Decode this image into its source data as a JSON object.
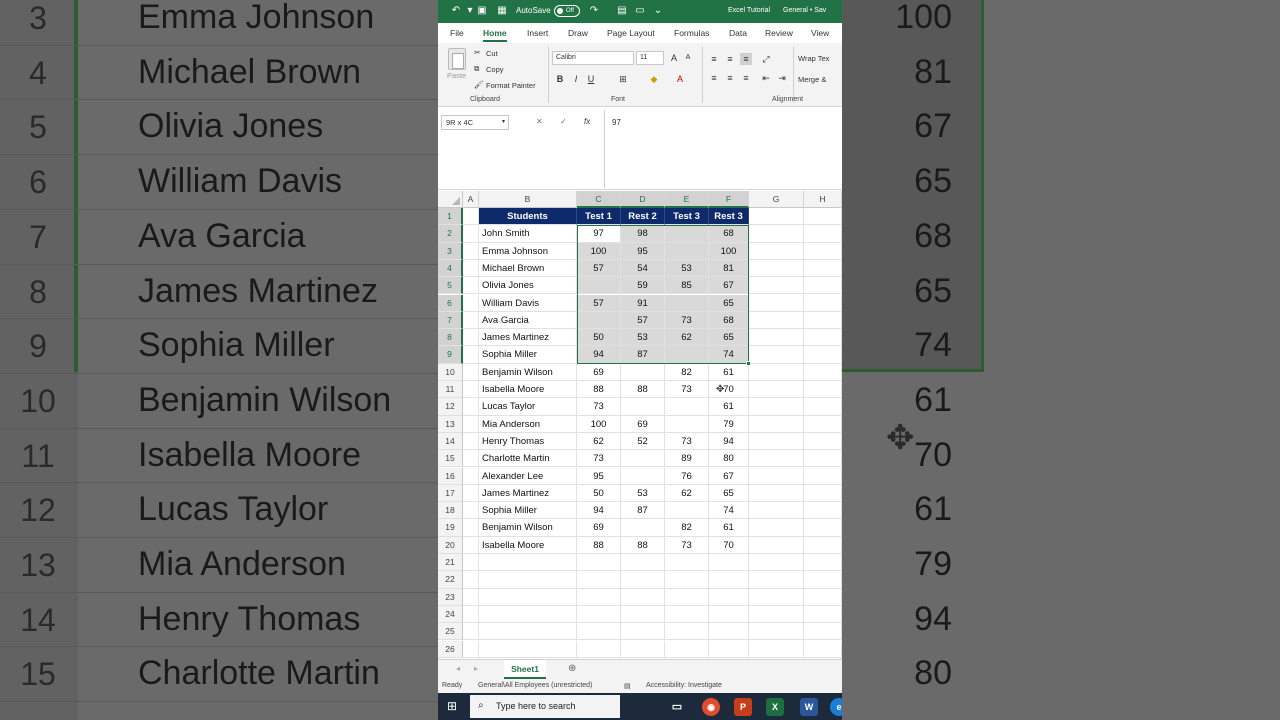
{
  "background": {
    "left_rows": [
      {
        "num": "3",
        "name": "Emma Johnson"
      },
      {
        "num": "4",
        "name": "Michael Brown"
      },
      {
        "num": "5",
        "name": "Olivia Jones"
      },
      {
        "num": "6",
        "name": "William Davis"
      },
      {
        "num": "7",
        "name": "Ava Garcia"
      },
      {
        "num": "8",
        "name": "James Martinez"
      },
      {
        "num": "9",
        "name": "Sophia Miller"
      },
      {
        "num": "10",
        "name": "Benjamin Wilson"
      },
      {
        "num": "11",
        "name": "Isabella Moore"
      },
      {
        "num": "12",
        "name": "Lucas Taylor"
      },
      {
        "num": "13",
        "name": "Mia Anderson"
      },
      {
        "num": "14",
        "name": "Henry Thomas"
      },
      {
        "num": "15",
        "name": "Charlotte Martin"
      }
    ],
    "right_values": [
      "100",
      "81",
      "67",
      "65",
      "68",
      "65",
      "74",
      "61",
      "70",
      "61",
      "79",
      "94",
      "80"
    ]
  },
  "titlebar": {
    "autosave_label": "AutoSave",
    "autosave_state": "Off",
    "doc_title": "Excel Tutorial",
    "sensitivity": "General • Sav"
  },
  "tabs": [
    "File",
    "Home",
    "Insert",
    "Draw",
    "Page Layout",
    "Formulas",
    "Data",
    "Review",
    "View"
  ],
  "ribbon": {
    "paste": "Paste",
    "cut": "Cut",
    "copy": "Copy",
    "format_painter": "Format Painter",
    "clipboard": "Clipboard",
    "font_name": "Calibri",
    "font_size": "11",
    "font_group": "Font",
    "wrap_text": "Wrap Tex",
    "merge": "Merge &",
    "alignment": "Alignment",
    "bold": "B",
    "italic": "I",
    "underline": "U"
  },
  "formula_bar": {
    "name_box": "9R x 4C",
    "value": "97"
  },
  "columns": [
    "A",
    "B",
    "C",
    "D",
    "E",
    "F",
    "G",
    "H"
  ],
  "table": {
    "headers": [
      "Students",
      "Test 1",
      "Rest 2",
      "Test 3",
      "Rest 3"
    ],
    "rows": [
      [
        "John Smith",
        "97",
        "98",
        "",
        "68"
      ],
      [
        "Emma Johnson",
        "100",
        "95",
        "",
        "100"
      ],
      [
        "Michael Brown",
        "57",
        "54",
        "53",
        "81"
      ],
      [
        "Olivia Jones",
        "",
        "59",
        "85",
        "67"
      ],
      [
        "William Davis",
        "57",
        "91",
        "",
        "65"
      ],
      [
        "Ava Garcia",
        "",
        "57",
        "73",
        "68"
      ],
      [
        "James Martinez",
        "50",
        "53",
        "62",
        "65"
      ],
      [
        "Sophia Miller",
        "94",
        "87",
        "",
        "74"
      ],
      [
        "Benjamin Wilson",
        "69",
        "",
        "82",
        "61"
      ],
      [
        "Isabella Moore",
        "88",
        "88",
        "73",
        "70"
      ],
      [
        "Lucas Taylor",
        "73",
        "",
        "",
        "61"
      ],
      [
        "Mia Anderson",
        "100",
        "69",
        "",
        "79"
      ],
      [
        "Henry Thomas",
        "62",
        "52",
        "73",
        "94"
      ],
      [
        "Charlotte Martin",
        "73",
        "",
        "89",
        "80"
      ],
      [
        "Alexander Lee",
        "95",
        "",
        "76",
        "67"
      ],
      [
        "James Martinez",
        "50",
        "53",
        "62",
        "65"
      ],
      [
        "Sophia Miller",
        "94",
        "87",
        "",
        "74"
      ],
      [
        "Benjamin Wilson",
        "69",
        "",
        "82",
        "61"
      ],
      [
        "Isabella Moore",
        "88",
        "88",
        "73",
        "70"
      ]
    ]
  },
  "row_numbers": [
    "1",
    "2",
    "3",
    "4",
    "5",
    "6",
    "7",
    "8",
    "9",
    "10",
    "11",
    "12",
    "13",
    "14",
    "15",
    "16",
    "17",
    "18",
    "19",
    "20",
    "21",
    "22",
    "23",
    "24",
    "25",
    "26"
  ],
  "sheet_tab": "Sheet1",
  "status": {
    "ready": "Ready",
    "sensitivity": "General\\All Employees (unrestricted)",
    "accessibility": "Accessibility: Investigate"
  },
  "taskbar": {
    "search_placeholder": "Type here to search"
  },
  "colors": {
    "excel_green": "#217346",
    "header_navy": "#0e2a6b",
    "selection_shade": "#d9d9d9"
  }
}
